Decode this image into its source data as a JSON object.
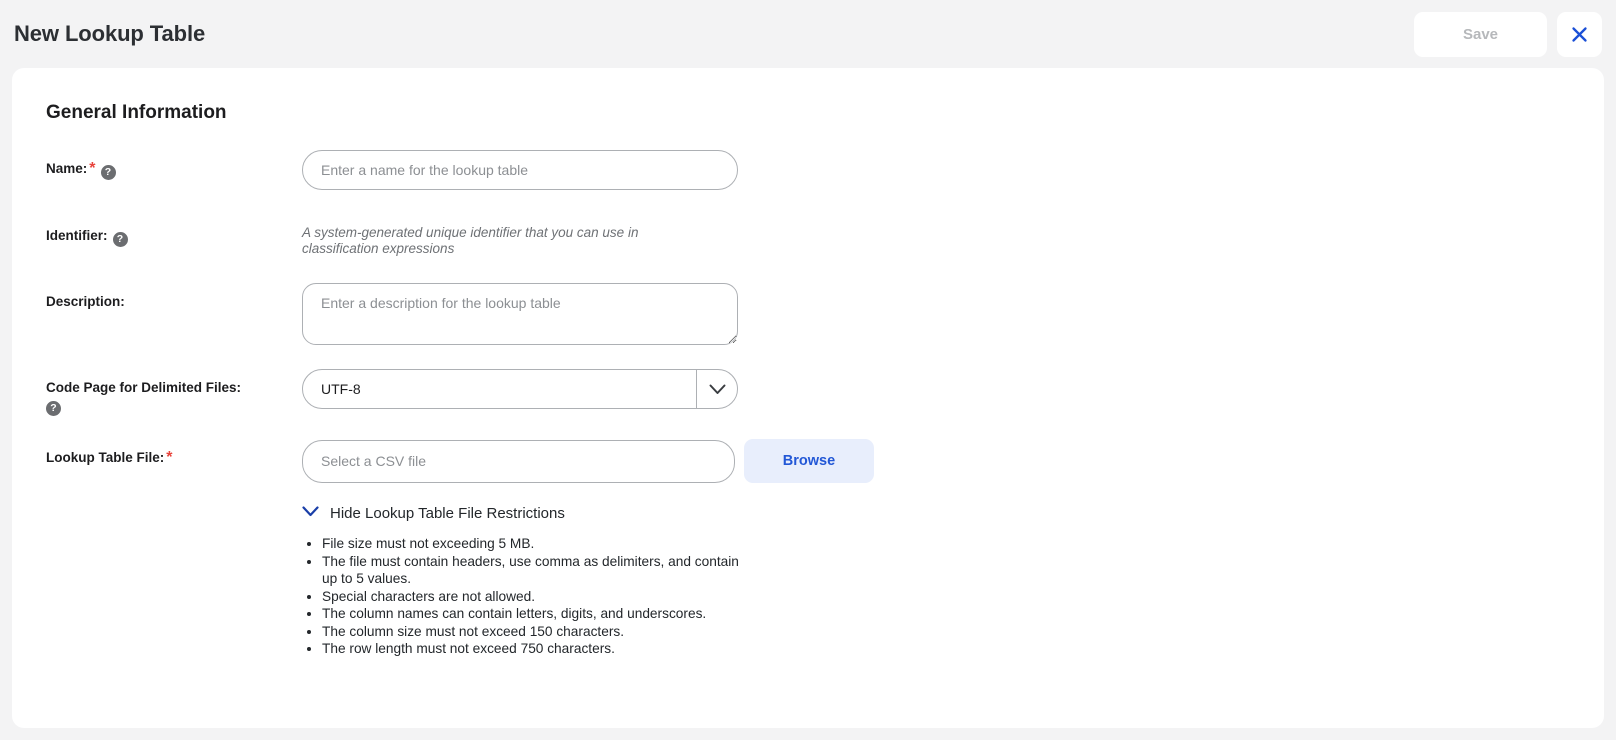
{
  "header": {
    "title": "New Lookup Table",
    "save_label": "Save",
    "close_icon": "close-x-icon",
    "accent_blue": "#1a56db",
    "save_disabled_color": "#b6b8bb"
  },
  "card": {
    "section_title": "General Information"
  },
  "form": {
    "name": {
      "label": "Name:",
      "required_marker": "*",
      "help_icon": "help-question-icon",
      "placeholder": "Enter a name for the lookup table",
      "value": ""
    },
    "identifier": {
      "label": "Identifier:",
      "help_icon": "help-question-icon",
      "helper_text": "A system-generated unique identifier that you can use in classification expressions"
    },
    "description": {
      "label": "Description:",
      "placeholder": "Enter a description for the lookup table",
      "value": ""
    },
    "code_page": {
      "label": "Code Page for Delimited Files:",
      "help_icon": "help-question-icon",
      "selected": "UTF-8",
      "chevron_icon": "chevron-down-icon"
    },
    "lookup_file": {
      "label": "Lookup Table File:",
      "required_marker": "*",
      "placeholder": "Select a CSV file",
      "value": "",
      "browse_label": "Browse"
    },
    "restrictions": {
      "toggle_label": "Hide Lookup Table File Restrictions",
      "toggle_icon": "chevron-down-icon",
      "items": [
        "File size must not exceeding 5 MB.",
        "The file must contain headers, use comma as delimiters, and contain up to 5 values.",
        "Special characters are not allowed.",
        "The column names can contain letters, digits, and underscores.",
        "The column size must not exceed 150 characters.",
        "The row length must not exceed 750 characters."
      ]
    }
  }
}
